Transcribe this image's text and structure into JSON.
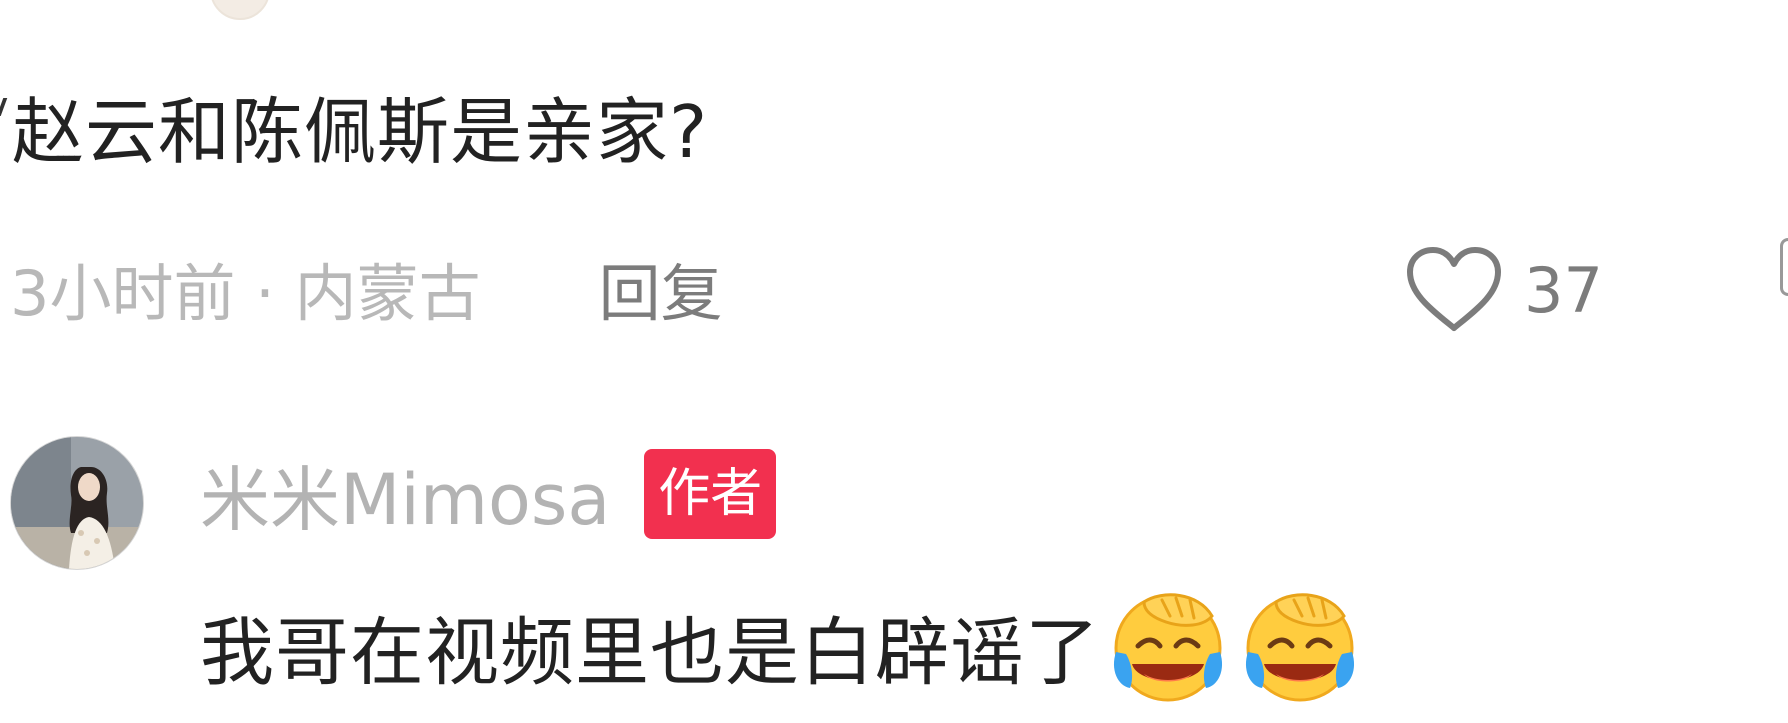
{
  "comment": {
    "text": "赵云和陈佩斯是亲家?",
    "meta": "3小时前 · 内蒙古",
    "reply_label": "回复",
    "like_count": "37",
    "like_icon": "heart-outline-icon"
  },
  "author_reply": {
    "username": "米米Mimosa",
    "badge": "作者",
    "text": "我哥在视频里也是白辟谣了",
    "emojis": [
      "facepalm-laughing-crying-emoji",
      "facepalm-laughing-crying-emoji"
    ]
  },
  "colors": {
    "badge_bg": "#f2304f",
    "primary_text": "#222222",
    "meta_text": "#b8b8b8",
    "action_text": "#7c7c7c"
  }
}
